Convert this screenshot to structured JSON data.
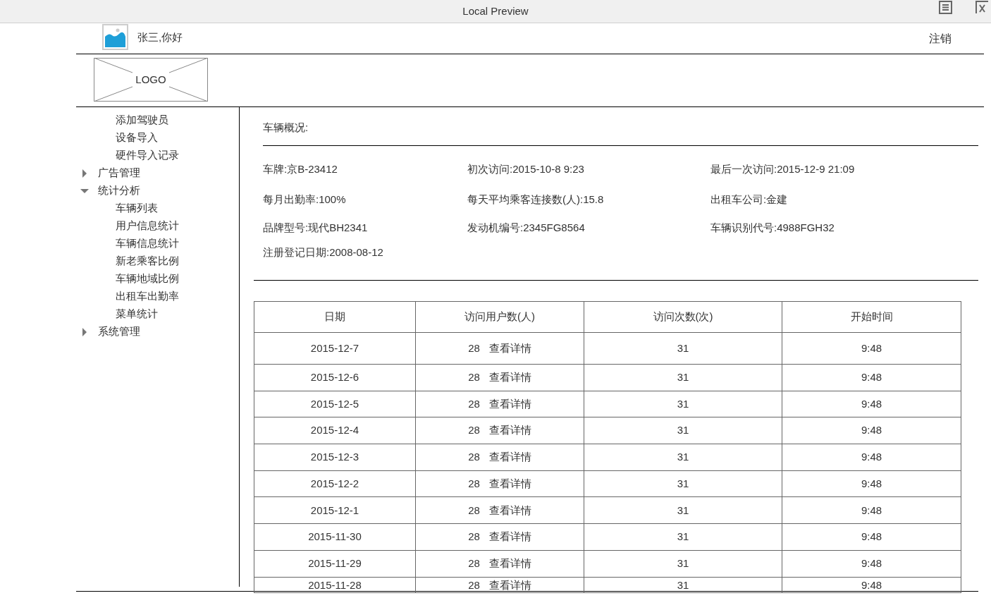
{
  "window": {
    "title": "Local Preview"
  },
  "header": {
    "greeting": "张三,你好",
    "logout": "注销",
    "logo": "LOGO"
  },
  "sidebar": {
    "items": [
      {
        "children": [
          {
            "label": "添加驾驶员"
          },
          {
            "label": "设备导入"
          },
          {
            "label": "硬件导入记录"
          }
        ]
      },
      {
        "label": "广告管理",
        "expanded": false
      },
      {
        "label": "统计分析",
        "expanded": true,
        "children": [
          {
            "label": "车辆列表"
          },
          {
            "label": "用户信息统计"
          },
          {
            "label": "车辆信息统计"
          },
          {
            "label": "新老乘客比例"
          },
          {
            "label": "车辆地域比例"
          },
          {
            "label": "出租车出勤率"
          },
          {
            "label": "菜单统计"
          }
        ]
      },
      {
        "label": "系统管理",
        "expanded": false
      }
    ]
  },
  "overview": {
    "title": "车辆概况:",
    "fields": [
      [
        "车牌:京B-23412",
        "初次访问:2015-10-8 9:23",
        "最后一次访问:2015-12-9 21:09"
      ],
      [
        "每月出勤率:100%",
        "每天平均乘客连接数(人):15.8",
        "出租车公司:金建"
      ],
      [
        "品牌型号:现代BH2341",
        "发动机编号:2345FG8564",
        "车辆识别代号:4988FGH32"
      ],
      [
        "注册登记日期:2008-08-12"
      ]
    ]
  },
  "table": {
    "columns": [
      "日期",
      "访问用户数(人)",
      "访问次数(次)",
      "开始时间"
    ],
    "rows": [
      {
        "date": "2015-12-7",
        "users": "28",
        "link": "查看详情",
        "visits": "31",
        "start": "9:48"
      },
      {
        "date": "2015-12-6",
        "users": "28",
        "link": "查看详情",
        "visits": "31",
        "start": "9:48"
      },
      {
        "date": "2015-12-5",
        "users": "28",
        "link": "查看详情",
        "visits": "31",
        "start": "9:48"
      },
      {
        "date": "2015-12-4",
        "users": "28",
        "link": "查看详情",
        "visits": "31",
        "start": "9:48"
      },
      {
        "date": "2015-12-3",
        "users": "28",
        "link": "查看详情",
        "visits": "31",
        "start": "9:48"
      },
      {
        "date": "2015-12-2",
        "users": "28",
        "link": "查看详情",
        "visits": "31",
        "start": "9:48"
      },
      {
        "date": "2015-12-1",
        "users": "28",
        "link": "查看详情",
        "visits": "31",
        "start": "9:48"
      },
      {
        "date": "2015-11-30",
        "users": "28",
        "link": "查看详情",
        "visits": "31",
        "start": "9:48"
      },
      {
        "date": "2015-11-29",
        "users": "28",
        "link": "查看详情",
        "visits": "31",
        "start": "9:48"
      },
      {
        "date": "2015-11-28",
        "users": "28",
        "link": "查看详情",
        "visits": "31",
        "start": "9:48"
      }
    ]
  }
}
